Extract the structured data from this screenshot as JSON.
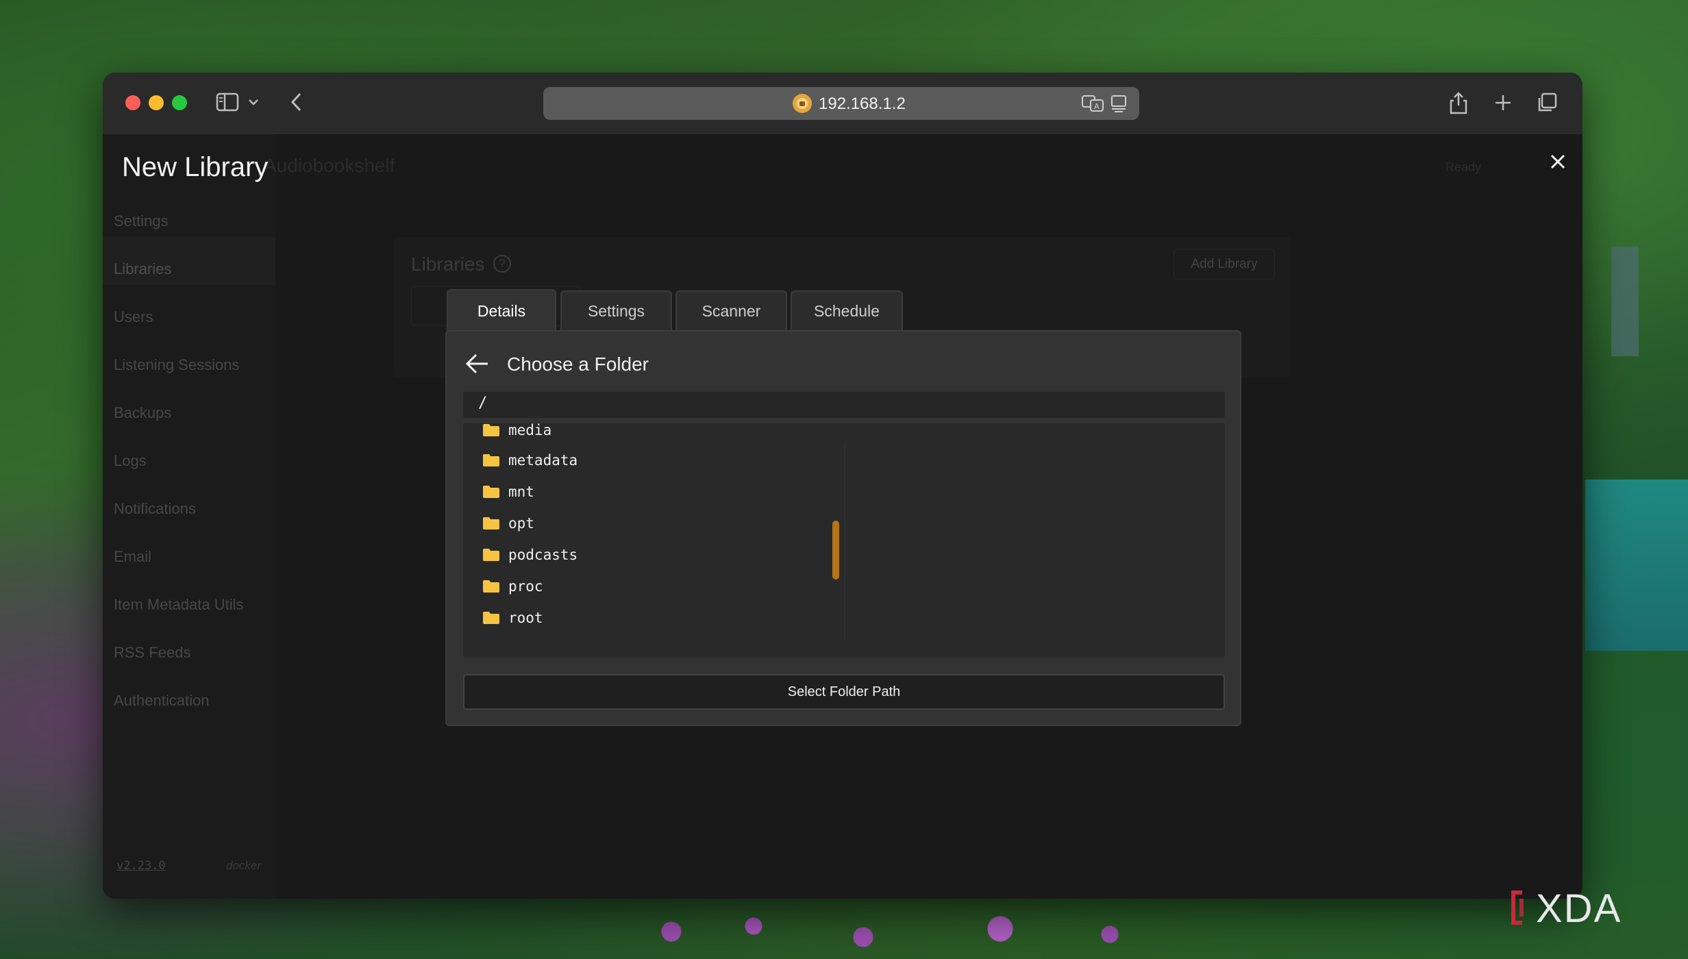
{
  "browser": {
    "url": "192.168.1.2"
  },
  "app": {
    "header_blur": "Audiobookshelf",
    "header_right_blur": "Ready",
    "sidebar": {
      "items": [
        {
          "label": "Settings"
        },
        {
          "label": "Libraries"
        },
        {
          "label": "Users"
        },
        {
          "label": "Listening Sessions"
        },
        {
          "label": "Backups"
        },
        {
          "label": "Logs"
        },
        {
          "label": "Notifications"
        },
        {
          "label": "Email"
        },
        {
          "label": "Item Metadata Utils"
        },
        {
          "label": "RSS Feeds"
        },
        {
          "label": "Authentication"
        }
      ],
      "version": "v2.23.0",
      "platform": "docker"
    },
    "libraries_card": {
      "title": "Libraries",
      "help": "?",
      "add_library": "Add Library"
    }
  },
  "modal": {
    "title": "New Library",
    "tabs": [
      {
        "label": "Details",
        "active": true
      },
      {
        "label": "Settings",
        "active": false
      },
      {
        "label": "Scanner",
        "active": false
      },
      {
        "label": "Schedule",
        "active": false
      }
    ],
    "panel": {
      "heading": "Choose a Folder",
      "current_path": "/",
      "folders": [
        {
          "name": "media"
        },
        {
          "name": "metadata"
        },
        {
          "name": "mnt"
        },
        {
          "name": "opt"
        },
        {
          "name": "podcasts"
        },
        {
          "name": "proc"
        },
        {
          "name": "root"
        }
      ],
      "select_button": "Select Folder Path"
    }
  },
  "colors": {
    "folder_yellow": "#f5c542",
    "scroll_thumb": "#b57416",
    "site_icon": "#e6a63a"
  },
  "watermark": "XDA"
}
